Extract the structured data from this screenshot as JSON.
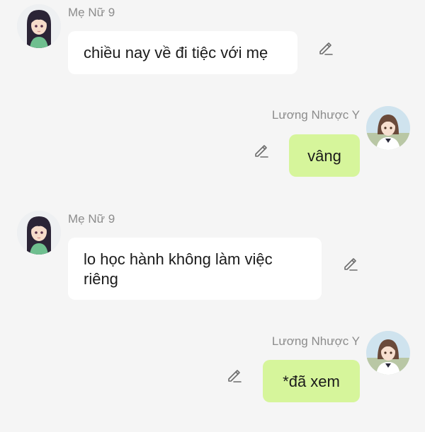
{
  "messages": [
    {
      "sender": "Mẹ Nữ 9",
      "text": "chiều nay về đi tiệc với mẹ",
      "direction": "incoming",
      "avatar_icon": "girl-long-hair-avatar",
      "action_icon": "edit-pencil-icon"
    },
    {
      "sender": "Lương Nhược Y",
      "text": "vâng",
      "direction": "outgoing",
      "avatar_icon": "schoolgirl-avatar",
      "action_icon": "edit-pencil-icon"
    },
    {
      "sender": "Mẹ Nữ 9",
      "text": "lo học hành không làm việc riêng",
      "direction": "incoming",
      "avatar_icon": "girl-long-hair-avatar",
      "action_icon": "edit-pencil-icon"
    },
    {
      "sender": "Lương Nhược Y",
      "text": "*đã xem",
      "direction": "outgoing",
      "avatar_icon": "schoolgirl-avatar",
      "action_icon": "edit-pencil-icon"
    }
  ],
  "colors": {
    "background": "#f5f5f5",
    "incoming_bubble": "#ffffff",
    "outgoing_bubble": "#d6f59b",
    "sender_name": "#8c8c8c",
    "message_text": "#1b1b1b"
  }
}
